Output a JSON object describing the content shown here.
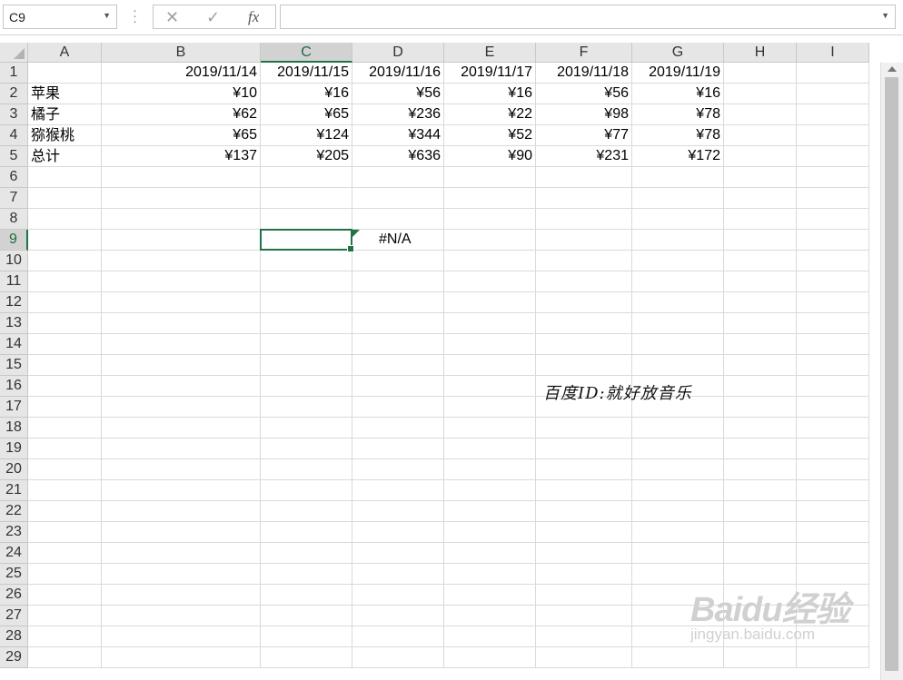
{
  "formula_bar": {
    "name_box": "C9",
    "cancel_icon": "✕",
    "enter_icon": "✓",
    "fx_label": "fx",
    "formula": ""
  },
  "columns": [
    "A",
    "B",
    "C",
    "D",
    "E",
    "F",
    "G",
    "H",
    "I"
  ],
  "selected_column": "C",
  "rows": [
    "1",
    "2",
    "3",
    "4",
    "5",
    "6",
    "7",
    "8",
    "9",
    "10",
    "11",
    "12",
    "13",
    "14",
    "15",
    "16",
    "17",
    "18",
    "19",
    "20",
    "21",
    "22",
    "23",
    "24",
    "25",
    "26",
    "27",
    "28",
    "29"
  ],
  "selected_row": "9",
  "table": {
    "headers": [
      "",
      "2019/11/14",
      "2019/11/15",
      "2019/11/16",
      "2019/11/17",
      "2019/11/18",
      "2019/11/19"
    ],
    "body": [
      [
        "苹果",
        "¥10",
        "¥16",
        "¥56",
        "¥16",
        "¥56",
        "¥16"
      ],
      [
        "橘子",
        "¥62",
        "¥65",
        "¥236",
        "¥22",
        "¥98",
        "¥78"
      ],
      [
        "猕猴桃",
        "¥65",
        "¥124",
        "¥344",
        "¥52",
        "¥77",
        "¥78"
      ],
      [
        "总计",
        "¥137",
        "¥205",
        "¥636",
        "¥90",
        "¥231",
        "¥172"
      ]
    ]
  },
  "cell_d9": "#N/A",
  "floating_text": "百度ID:就好放音乐",
  "watermark": {
    "logo": "Baidu经验",
    "url": "jingyan.baidu.com"
  },
  "colors": {
    "accent": "#217346",
    "header_bg": "#e6e6e6",
    "gridline": "#dadada"
  }
}
